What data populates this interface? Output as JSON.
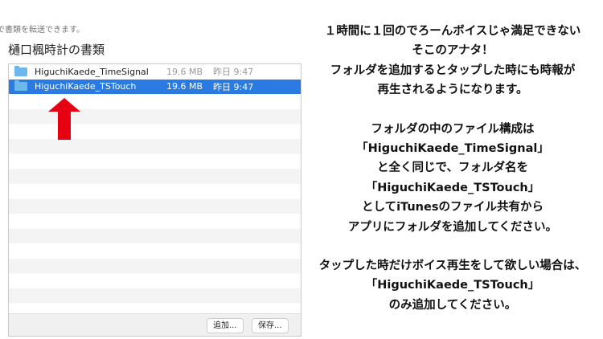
{
  "hint": "で書類を転送できます。",
  "title": "樋口楓時計の書類",
  "files": [
    {
      "name": "HiguchiKaede_TimeSignal",
      "size": "19.6 MB",
      "date": "昨日 9:47",
      "selected": false
    },
    {
      "name": "HiguchiKaede_TSTouch",
      "size": "19.6 MB",
      "date": "昨日 9:47",
      "selected": true
    }
  ],
  "buttons": {
    "add": "追加...",
    "save": "保存..."
  },
  "colors": {
    "selection": "#2a7ae2",
    "arrow": "#e60012"
  },
  "explanation": {
    "p1": [
      "１時間に１回のでろーんボイスじゃ満足できない",
      "そこのアナタ！",
      "フォルダを追加するとタップした時にも時報が",
      "再生されるようになります。"
    ],
    "p2": [
      "フォルダの中のファイル構成は",
      "「HiguchiKaede_TimeSignal」",
      "と全く同じで、フォルダ名を",
      "「HiguchiKaede_TSTouch」",
      "としてiTunesのファイル共有から",
      "アプリにフォルダを追加してください。"
    ],
    "p3": [
      "タップした時だけボイス再生をして欲しい場合は、",
      "「HiguchiKaede_TSTouch」",
      "のみ追加してください。"
    ]
  }
}
